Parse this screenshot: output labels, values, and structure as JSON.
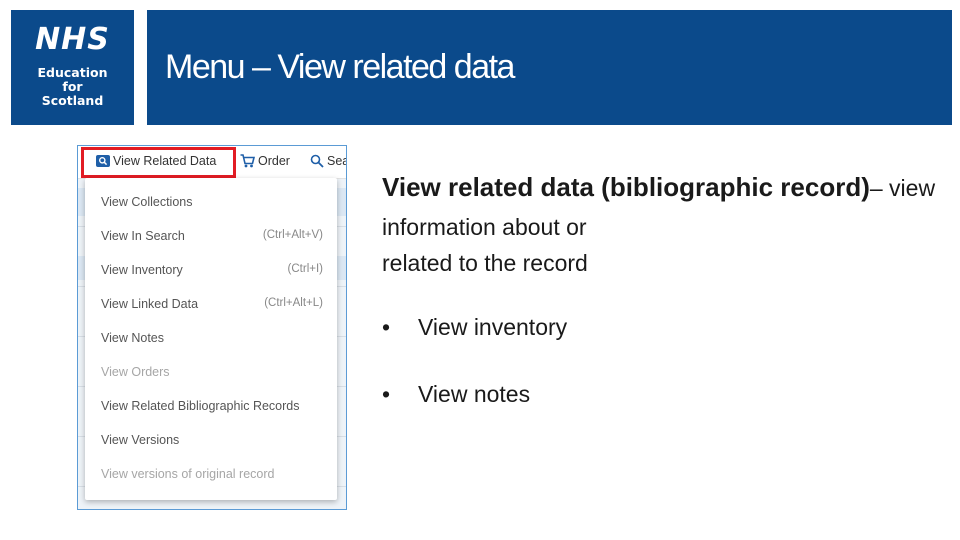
{
  "logo": {
    "brand": "NHS",
    "line1": "Education",
    "line2": "for",
    "line3": "Scotland"
  },
  "header": {
    "title": "Menu – View related data"
  },
  "screenshot": {
    "toolbar": {
      "view_related_label": "View Related Data",
      "order_label": "Order",
      "search_label": "Sea"
    },
    "menu_items": [
      {
        "label": "View Collections",
        "shortcut": "",
        "disabled": false
      },
      {
        "label": "View In Search",
        "shortcut": "(Ctrl+Alt+V)",
        "disabled": false
      },
      {
        "label": "View Inventory",
        "shortcut": "(Ctrl+I)",
        "disabled": false
      },
      {
        "label": "View Linked Data",
        "shortcut": "(Ctrl+Alt+L)",
        "disabled": false
      },
      {
        "label": "View Notes",
        "shortcut": "",
        "disabled": false
      },
      {
        "label": "View Orders",
        "shortcut": "",
        "disabled": true
      },
      {
        "label": "View Related Bibliographic Records",
        "shortcut": "",
        "disabled": false
      },
      {
        "label": "View Versions",
        "shortcut": "",
        "disabled": false
      },
      {
        "label": "View versions of original record",
        "shortcut": "",
        "disabled": true
      }
    ]
  },
  "content": {
    "heading_bold": "View related data (bibliographic record)",
    "heading_rest": "– view information about or",
    "line3": "related to the record",
    "bullets": [
      "View inventory",
      "View notes"
    ]
  },
  "colors": {
    "brand_blue": "#0b4a8b",
    "highlight_red": "#e21c24",
    "toolbar_icon_blue": "#1f5fa8"
  }
}
